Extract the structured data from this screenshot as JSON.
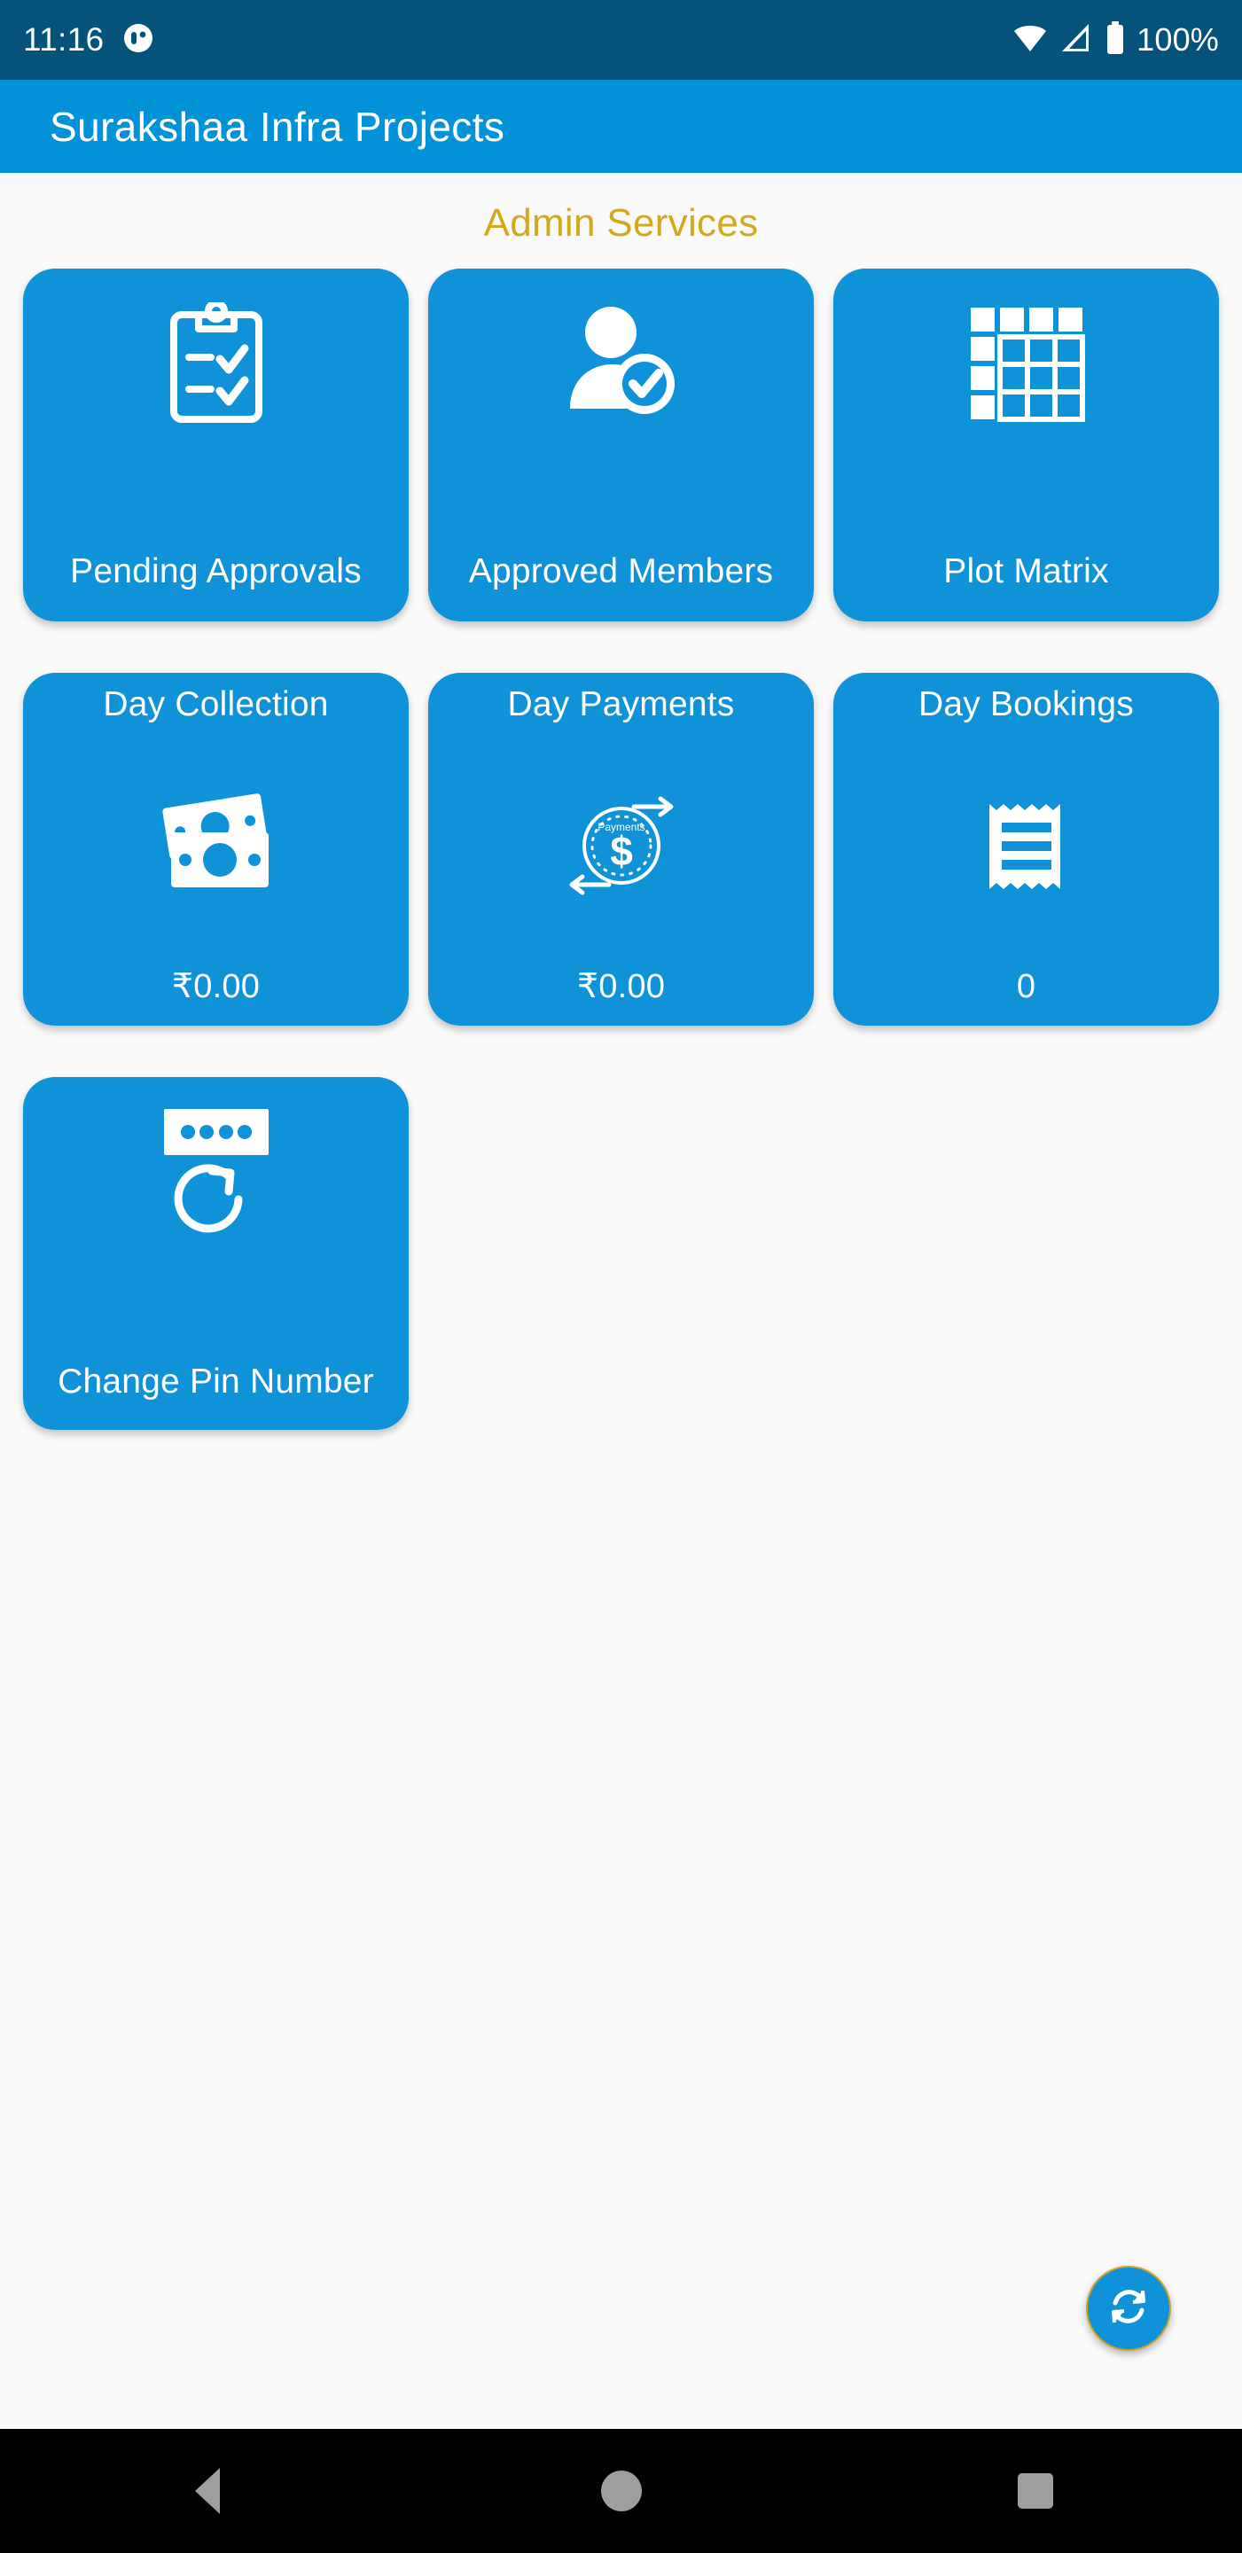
{
  "status_bar": {
    "time": "11:16",
    "notification_icon": "app-notification-icon",
    "wifi_icon": "wifi-icon",
    "signal_icon": "cellular-signal-icon",
    "battery_icon": "battery-full-icon",
    "battery_percent": "100%",
    "background_color": "#05527b"
  },
  "app_bar": {
    "title": "Surakshaa Infra Projects",
    "background_color": "#0292d8"
  },
  "section": {
    "title": "Admin Services",
    "title_color": "#d4a81c"
  },
  "card_color": "#0f92d7",
  "cards": [
    {
      "label": "Pending Approvals",
      "icon": "clipboard-check-icon",
      "layout": "icon-top"
    },
    {
      "label": "Approved Members",
      "icon": "user-approved-icon",
      "layout": "icon-top"
    },
    {
      "label": "Plot Matrix",
      "icon": "grid-matrix-icon",
      "layout": "icon-top"
    },
    {
      "label": "Day Collection",
      "icon": "banknotes-icon",
      "layout": "label-top",
      "value": "₹0.00"
    },
    {
      "label": "Day Payments",
      "icon": "payments-cycle-icon",
      "layout": "label-top",
      "value": "₹0.00"
    },
    {
      "label": "Day Bookings",
      "icon": "receipt-icon",
      "layout": "label-top",
      "value": "0"
    },
    {
      "label": "Change Pin Number",
      "icon": "pin-refresh-icon",
      "layout": "icon-top"
    }
  ],
  "fab": {
    "icon": "sync-refresh-icon",
    "background_color": "#0f92d7",
    "border_color": "#c9a227"
  },
  "nav_bar": {
    "back": "back-triangle-icon",
    "home": "home-circle-icon",
    "recents": "recents-square-icon"
  }
}
